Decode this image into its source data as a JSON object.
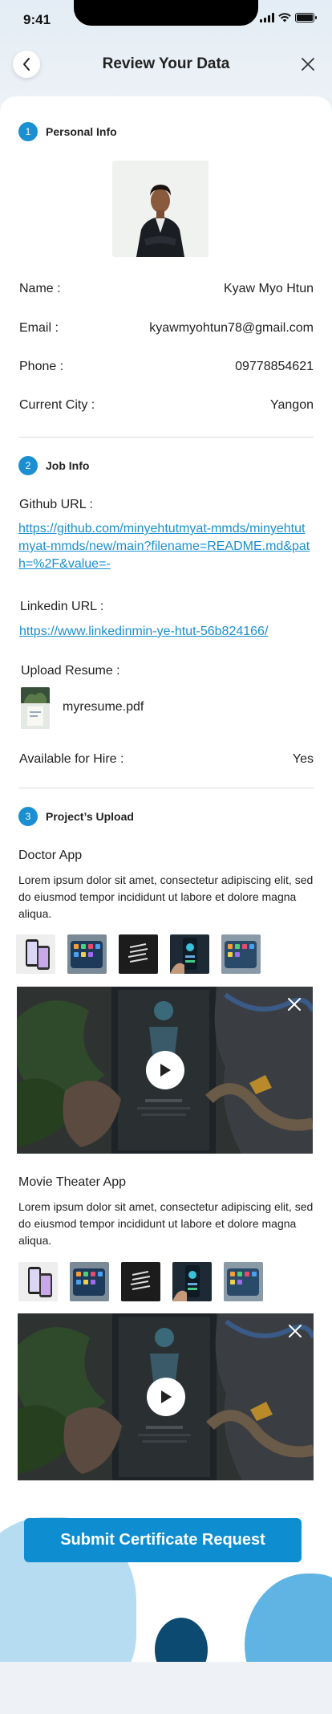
{
  "status_bar": {
    "time": "9:41"
  },
  "header": {
    "title": "Review Your Data"
  },
  "personal": {
    "step": "1",
    "title": "Personal Info",
    "rows": [
      {
        "label": "Name :",
        "value": "Kyaw Myo Htun"
      },
      {
        "label": "Email :",
        "value": "kyawmyohtun78@gmail.com"
      },
      {
        "label": "Phone :",
        "value": "09778854621"
      },
      {
        "label": "Current City :",
        "value": "Yangon"
      }
    ]
  },
  "job": {
    "step": "2",
    "title": "Job Info",
    "github_label": "Github URL :",
    "github_url": "https://github.com/minyehtutmyat-mmds/minyehtutmyat-mmds/new/main?filename=README.md&path=%2F&value=-",
    "linkedin_label": "Linkedin URL :",
    "linkedin_url": "https://www.linkedinmin-ye-htut-56b824166/",
    "resume_label": "Upload Resume :",
    "resume_file": "myresume.pdf",
    "hire_label": "Available for Hire :",
    "hire_value": "Yes"
  },
  "projects": {
    "step": "3",
    "title": "Project’s Upload",
    "items": [
      {
        "name": "Doctor App",
        "description": "Lorem ipsum dolor sit amet, consectetur adipiscing elit, sed do eiusmod tempor incididunt ut labore et dolore magna aliqua."
      },
      {
        "name": "Movie Theater App",
        "description": "Lorem ipsum dolor sit amet, consectetur adipiscing elit, sed do eiusmod tempor incididunt ut labore et dolore magna aliqua."
      }
    ]
  },
  "submit_label": "Submit Certificate Request",
  "icons": {
    "back": "chevron-left-icon",
    "close": "close-icon",
    "play": "play-icon"
  },
  "colors": {
    "accent": "#1a8fd1",
    "button": "#0e8ed0",
    "blob_light": "#b5dcf1",
    "blob_mid": "#5fb4e4",
    "blob_dark": "#0d4a72"
  }
}
